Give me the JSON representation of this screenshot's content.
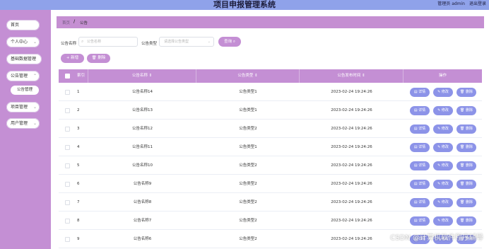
{
  "header": {
    "title": "项目申报管理系统",
    "user": "管理员 admin",
    "logout": "退出登录",
    "bg_color": "#8fa2ea"
  },
  "sidebar": {
    "bg_color": "#c48fd4",
    "items": [
      {
        "label": "首页"
      },
      {
        "label": "个人中心"
      },
      {
        "label": "基础数据管理"
      },
      {
        "label": "公告管理"
      },
      {
        "label": "公告管理",
        "sub": true
      },
      {
        "label": "项目管理"
      },
      {
        "label": "用户管理"
      }
    ]
  },
  "breadcrumb": {
    "home": "首页",
    "separator": "/",
    "current": "公告"
  },
  "filters": {
    "name_label": "公告名称",
    "name_placeholder": "公告名称",
    "type_label": "公告类型",
    "type_placeholder": "请选择公告类型",
    "search_label": "查询"
  },
  "actions": {
    "add": "新增",
    "delete": "删除"
  },
  "table": {
    "headers": {
      "index": "索引",
      "name": "公告名称",
      "type": "公告类型",
      "time": "公告发布时间",
      "ops": "操作"
    },
    "op_labels": {
      "detail": "详情",
      "edit": "修改",
      "delete": "删除"
    },
    "rows": [
      {
        "index": "1",
        "name": "公告名称14",
        "type": "公告类型1",
        "time": "2023-02-24 19:24:26"
      },
      {
        "index": "2",
        "name": "公告名称13",
        "type": "公告类型1",
        "time": "2023-02-24 19:24:26"
      },
      {
        "index": "3",
        "name": "公告名称12",
        "type": "公告类型2",
        "time": "2023-02-24 19:24:26"
      },
      {
        "index": "4",
        "name": "公告名称11",
        "type": "公告类型1",
        "time": "2023-02-24 19:24:26"
      },
      {
        "index": "5",
        "name": "公告名称10",
        "type": "公告类型2",
        "time": "2023-02-24 19:24:26"
      },
      {
        "index": "6",
        "name": "公告名称9",
        "type": "公告类型2",
        "time": "2023-02-24 19:24:26"
      },
      {
        "index": "7",
        "name": "公告名称8",
        "type": "公告类型2",
        "time": "2023-02-24 19:24:26"
      },
      {
        "index": "8",
        "name": "公告名称7",
        "type": "公告类型2",
        "time": "2023-02-24 19:24:26"
      },
      {
        "index": "9",
        "name": "公告名称6",
        "type": "公告类型2",
        "time": "2023-02-24 19:24:26"
      }
    ]
  },
  "watermark": "CSDN @计算机软件程序辅导",
  "colors": {
    "accent": "#c48fd4",
    "op_button": "#8c93e8"
  }
}
